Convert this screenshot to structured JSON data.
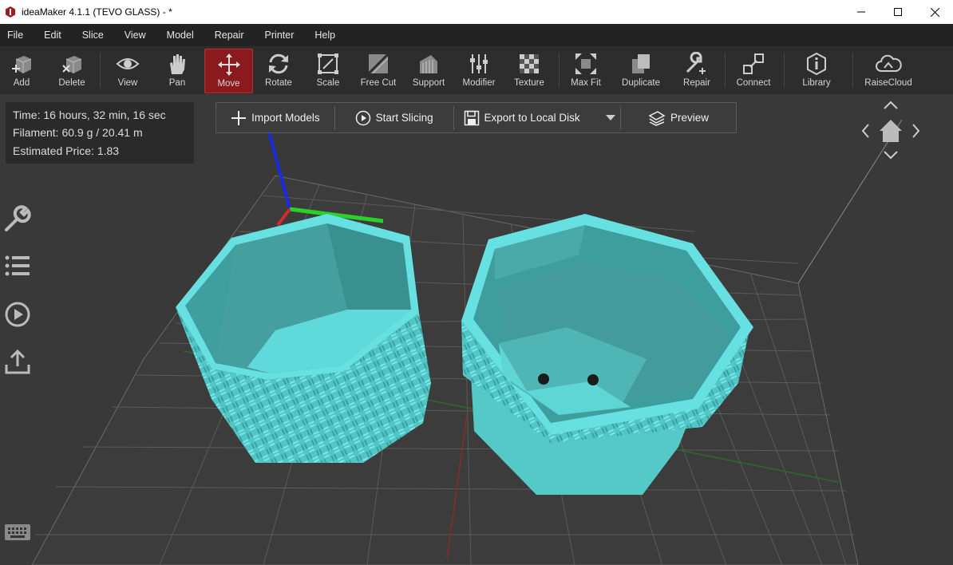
{
  "window": {
    "title": "ideaMaker 4.1.1 (TEVO GLASS) - *"
  },
  "menu": [
    "File",
    "Edit",
    "Slice",
    "View",
    "Model",
    "Repair",
    "Printer",
    "Help"
  ],
  "toolbar": {
    "tools": [
      {
        "label": "Add",
        "icon": "add-icon"
      },
      {
        "label": "Delete",
        "icon": "delete-icon"
      },
      {
        "label": "View",
        "icon": "eye-icon"
      },
      {
        "label": "Pan",
        "icon": "hand-icon"
      },
      {
        "label": "Move",
        "icon": "move-icon",
        "active": true
      },
      {
        "label": "Rotate",
        "icon": "rotate-icon"
      },
      {
        "label": "Scale",
        "icon": "scale-icon"
      },
      {
        "label": "Free Cut",
        "icon": "free-cut-icon"
      },
      {
        "label": "Support",
        "icon": "support-icon"
      },
      {
        "label": "Modifier",
        "icon": "modifier-icon"
      },
      {
        "label": "Texture",
        "icon": "texture-icon"
      },
      {
        "label": "Max Fit",
        "icon": "max-fit-icon"
      },
      {
        "label": "Duplicate",
        "icon": "duplicate-icon"
      },
      {
        "label": "Repair",
        "icon": "repair-icon"
      },
      {
        "label": "Connect",
        "icon": "connect-icon"
      },
      {
        "label": "Library",
        "icon": "library-icon"
      },
      {
        "label": "RaiseCloud",
        "icon": "cloud-icon"
      }
    ]
  },
  "info": {
    "time": "Time: 16 hours, 32 min, 16 sec",
    "filament": "Filament: 60.9 g / 20.41 m",
    "price": "Estimated Price: 1.83"
  },
  "actions": {
    "import": "Import Models",
    "slice": "Start Slicing",
    "export": "Export to Local Disk",
    "preview": "Preview"
  },
  "sidebar": [
    "wrench-icon",
    "list-icon",
    "play-icon",
    "upload-icon",
    "keyboard-icon"
  ],
  "colors": {
    "accent": "#8b1a1f",
    "model": "#5ee0e0",
    "background": "#393939"
  }
}
